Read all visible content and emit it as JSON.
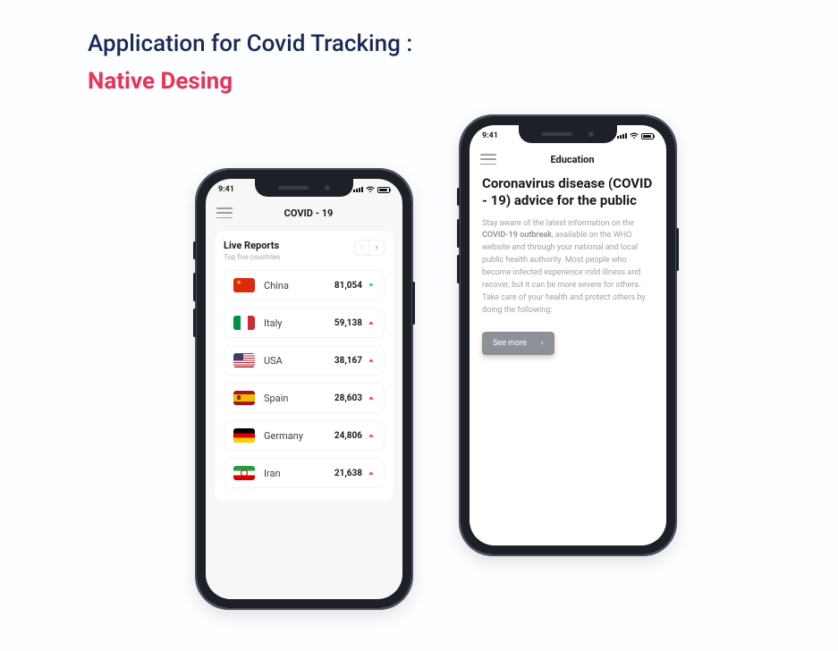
{
  "heading": {
    "line1": "Application for Covid Tracking :",
    "line2": "Native Desing"
  },
  "status": {
    "time": "9:41"
  },
  "phone1": {
    "nav_title": "COVID - 19",
    "reports": {
      "title": "Live Reports",
      "subtitle": "Top five countries",
      "pager_prev": "‹",
      "pager_next": "›"
    },
    "countries": [
      {
        "name": "China",
        "value": "81,054",
        "trend": "down",
        "flag": "cn"
      },
      {
        "name": "Italy",
        "value": "59,138",
        "trend": "up",
        "flag": "it"
      },
      {
        "name": "USA",
        "value": "38,167",
        "trend": "up",
        "flag": "us"
      },
      {
        "name": "Spain",
        "value": "28,603",
        "trend": "up",
        "flag": "es"
      },
      {
        "name": "Germany",
        "value": "24,806",
        "trend": "up",
        "flag": "de"
      },
      {
        "name": "Iran",
        "value": "21,638",
        "trend": "up",
        "flag": "ir"
      }
    ]
  },
  "phone2": {
    "nav_title": "Education",
    "article": {
      "title": "Coronavirus disease (COVID - 19) advice for the public",
      "body_pre": "Stay aware of the latest information on the ",
      "body_bold": "COVID-19 outbreak",
      "body_post": ", available on the WHO website and through your national and local public health authority. Most people who become infected experience mild illness and recover, but it can be more severe for others. Take care of your health and protect others by doing the following:",
      "cta": "See more"
    }
  }
}
